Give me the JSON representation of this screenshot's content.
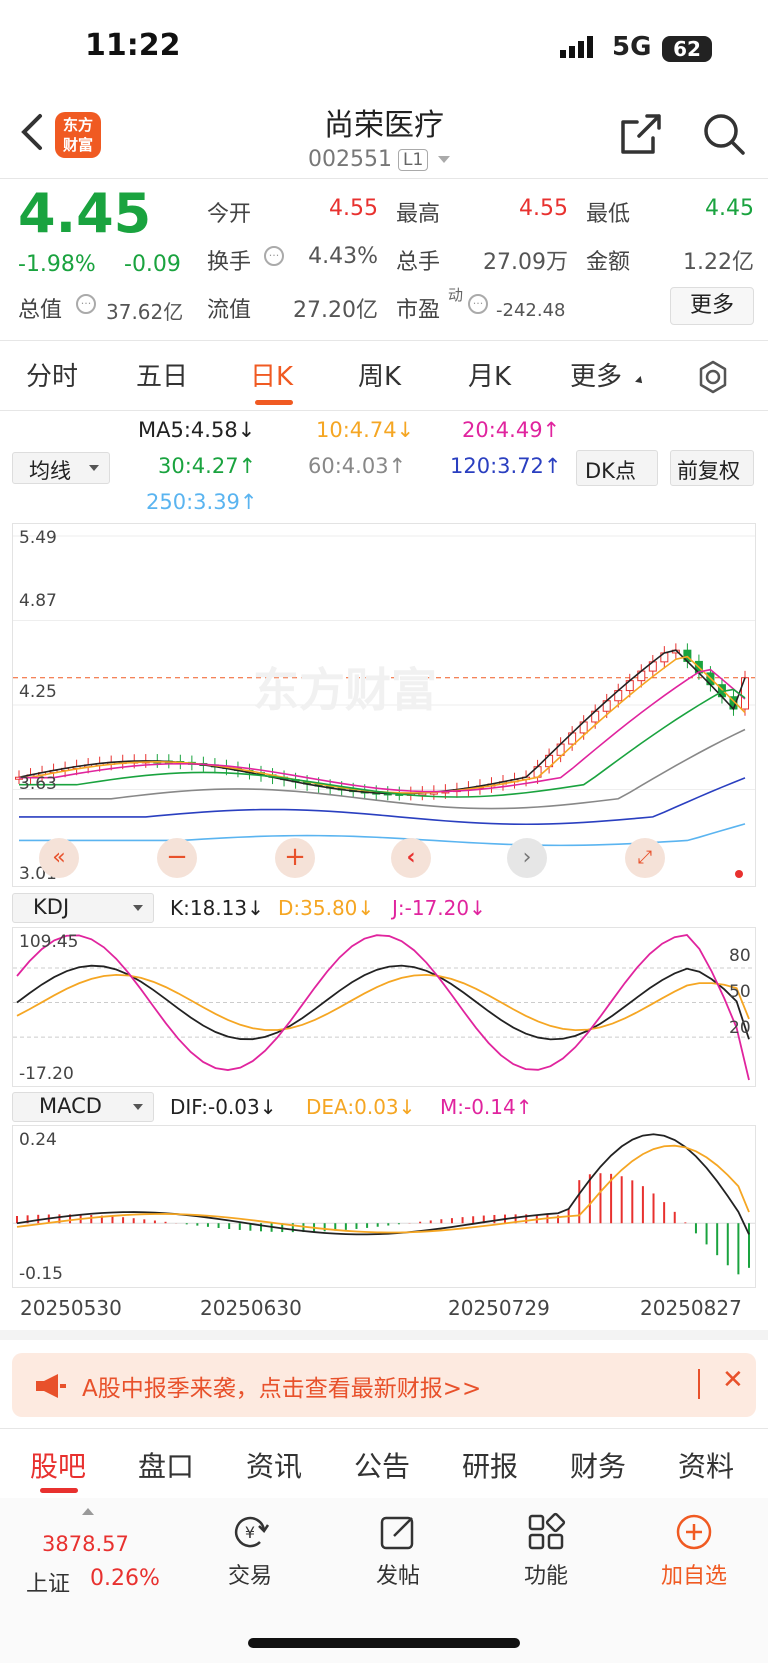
{
  "status": {
    "time": "11:22",
    "network": "5G",
    "battery": "62"
  },
  "header": {
    "title": "尚荣医疗",
    "code": "002551",
    "level": "L1",
    "logo": "东方\n财富"
  },
  "quote": {
    "price": "4.45",
    "change_pct": "-1.98%",
    "change": "-0.09",
    "open_label": "今开",
    "open": "4.55",
    "high_label": "最高",
    "high": "4.55",
    "low_label": "最低",
    "low": "4.45",
    "turnover_label": "换手",
    "turnover": "4.43%",
    "volume_label": "总手",
    "volume": "27.09万",
    "amount_label": "金额",
    "amount": "1.22亿",
    "mktcap_label": "总值",
    "mktcap": "37.62亿",
    "float_label": "流值",
    "float": "27.20亿",
    "pe_label": "市盈",
    "pe_sup": "动",
    "pe": "-242.48",
    "more": "更多"
  },
  "period_tabs": [
    "分时",
    "五日",
    "日K",
    "周K",
    "月K",
    "更多"
  ],
  "ma": {
    "selector": "均线",
    "ma5": "MA5:4.58↓",
    "ma10": "10:4.74↓",
    "ma20": "20:4.49↑",
    "ma30": "30:4.27↑",
    "ma60": "60:4.03↑",
    "ma120": "120:3.72↑",
    "ma250": "250:3.39↑",
    "dk": "DK点",
    "adjust": "前复权",
    "colors": {
      "ma5": "#222222",
      "ma10": "#f5a623",
      "ma20": "#e0249e",
      "ma30": "#1aa33f",
      "ma60": "#888888",
      "ma120": "#2a3fc0",
      "ma250": "#5ab4f0"
    }
  },
  "kline_axis": {
    "top": "5.49",
    "mid1": "4.87",
    "mid2": "4.25",
    "low": "3.63",
    "bottom": "3.01"
  },
  "watermark": "东方财富",
  "kdj": {
    "selector": "KDJ",
    "k": "K:18.13↓",
    "d": "D:35.80↓",
    "j": "J:-17.20↓",
    "top": "109.45",
    "bottom": "-17.20",
    "l80": "80",
    "l50": "50",
    "l20": "20"
  },
  "macd": {
    "selector": "MACD",
    "dif": "DIF:-0.03↓",
    "dea": "DEA:0.03↓",
    "m": "M:-0.14↑",
    "top": "0.24",
    "bottom": "-0.15"
  },
  "dates": [
    "20250530",
    "20250630",
    "20250729",
    "20250827"
  ],
  "banner": {
    "text": "A股中报季来袭，点击查看最新财报>>",
    "close": "✕"
  },
  "bottom_tabs": [
    "股吧",
    "盘口",
    "资讯",
    "公告",
    "研报",
    "财务",
    "资料"
  ],
  "index": {
    "value": "3878.57",
    "name": "上证",
    "pct": "0.26%"
  },
  "toolbar": [
    "交易",
    "发帖",
    "功能",
    "加自选"
  ],
  "chart_data": {
    "type": "candlestick",
    "title": "日K",
    "ylim": [
      3.01,
      5.49
    ],
    "x": [
      "20250530",
      "20250630",
      "20250729",
      "20250827"
    ],
    "last_close": 4.45,
    "ma": {
      "MA5": 4.58,
      "MA10": 4.74,
      "MA20": 4.49,
      "MA30": 4.27,
      "MA60": 4.03,
      "MA120": 3.72,
      "MA250": 3.39
    },
    "kdj": {
      "K": 18.13,
      "D": 35.8,
      "J": -17.2,
      "ylim": [
        -17.2,
        109.45
      ]
    },
    "macd": {
      "DIF": -0.03,
      "DEA": 0.03,
      "M": -0.14,
      "ylim": [
        -0.15,
        0.24
      ]
    }
  }
}
